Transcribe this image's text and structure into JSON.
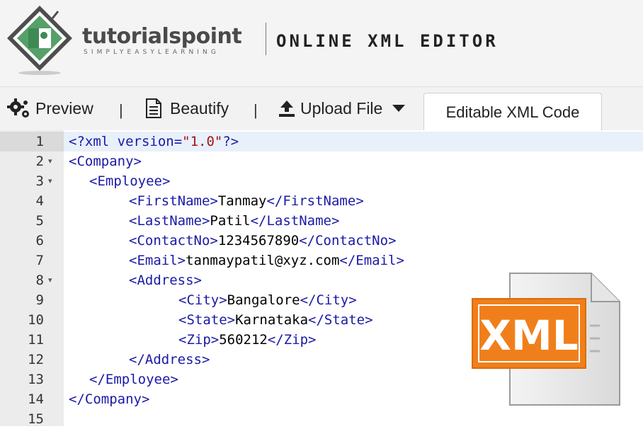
{
  "header": {
    "brand_name": "tutorialspoint",
    "brand_tagline": "SIMPLYEASYLEARNING",
    "app_title": "ONLINE XML EDITOR"
  },
  "toolbar": {
    "preview_label": "Preview",
    "beautify_label": "Beautify",
    "upload_label": "Upload File",
    "separator": "|",
    "active_tab_label": "Editable XML Code"
  },
  "icons": {
    "preview": "gears-icon",
    "beautify": "document-icon",
    "upload": "upload-icon",
    "dropdown": "caret-down-icon",
    "file": "xml-file-icon"
  },
  "colors": {
    "tag": "#1a1aa6",
    "string": "#a31515",
    "text": "#000000",
    "badge_orange": "#f07f1b",
    "active_line": "#e8f0fa"
  },
  "editor": {
    "lines": [
      {
        "num": "1",
        "fold": false,
        "parts": [
          {
            "t": "<?xml version=",
            "c": "pi"
          },
          {
            "t": "\"1.0\"",
            "c": "str"
          },
          {
            "t": "?>",
            "c": "pi"
          }
        ]
      },
      {
        "num": "2",
        "fold": true,
        "parts": [
          {
            "t": "<Company>",
            "c": "tag"
          }
        ]
      },
      {
        "num": "3",
        "fold": true,
        "parts": [
          {
            "t": "<Employee>",
            "c": "tag"
          }
        ]
      },
      {
        "num": "4",
        "fold": false,
        "parts": [
          {
            "t": "<FirstName>",
            "c": "tag"
          },
          {
            "t": "Tanmay",
            "c": "txt"
          },
          {
            "t": "</FirstName>",
            "c": "tag"
          }
        ]
      },
      {
        "num": "5",
        "fold": false,
        "parts": [
          {
            "t": "<LastName>",
            "c": "tag"
          },
          {
            "t": "Patil",
            "c": "txt"
          },
          {
            "t": "</LastName>",
            "c": "tag"
          }
        ]
      },
      {
        "num": "6",
        "fold": false,
        "parts": [
          {
            "t": "<ContactNo>",
            "c": "tag"
          },
          {
            "t": "1234567890",
            "c": "txt"
          },
          {
            "t": "</ContactNo>",
            "c": "tag"
          }
        ]
      },
      {
        "num": "7",
        "fold": false,
        "parts": [
          {
            "t": "<Email>",
            "c": "tag"
          },
          {
            "t": "tanmaypatil@xyz.com",
            "c": "txt"
          },
          {
            "t": "</Email>",
            "c": "tag"
          }
        ]
      },
      {
        "num": "8",
        "fold": true,
        "parts": [
          {
            "t": "<Address>",
            "c": "tag"
          }
        ]
      },
      {
        "num": "9",
        "fold": false,
        "parts": [
          {
            "t": "<City>",
            "c": "tag"
          },
          {
            "t": "Bangalore",
            "c": "txt"
          },
          {
            "t": "</City>",
            "c": "tag"
          }
        ]
      },
      {
        "num": "10",
        "fold": false,
        "parts": [
          {
            "t": "<State>",
            "c": "tag"
          },
          {
            "t": "Karnataka",
            "c": "txt"
          },
          {
            "t": "</State>",
            "c": "tag"
          }
        ]
      },
      {
        "num": "11",
        "fold": false,
        "parts": [
          {
            "t": "<Zip>",
            "c": "tag"
          },
          {
            "t": "560212",
            "c": "txt"
          },
          {
            "t": "</Zip>",
            "c": "tag"
          }
        ]
      },
      {
        "num": "12",
        "fold": false,
        "parts": [
          {
            "t": "</Address>",
            "c": "tag"
          }
        ]
      },
      {
        "num": "13",
        "fold": false,
        "parts": [
          {
            "t": "</Employee>",
            "c": "tag"
          }
        ]
      },
      {
        "num": "14",
        "fold": false,
        "parts": [
          {
            "t": "</Company>",
            "c": "tag"
          }
        ]
      },
      {
        "num": "15",
        "fold": false,
        "parts": []
      }
    ]
  },
  "badge": {
    "label": "XML"
  }
}
